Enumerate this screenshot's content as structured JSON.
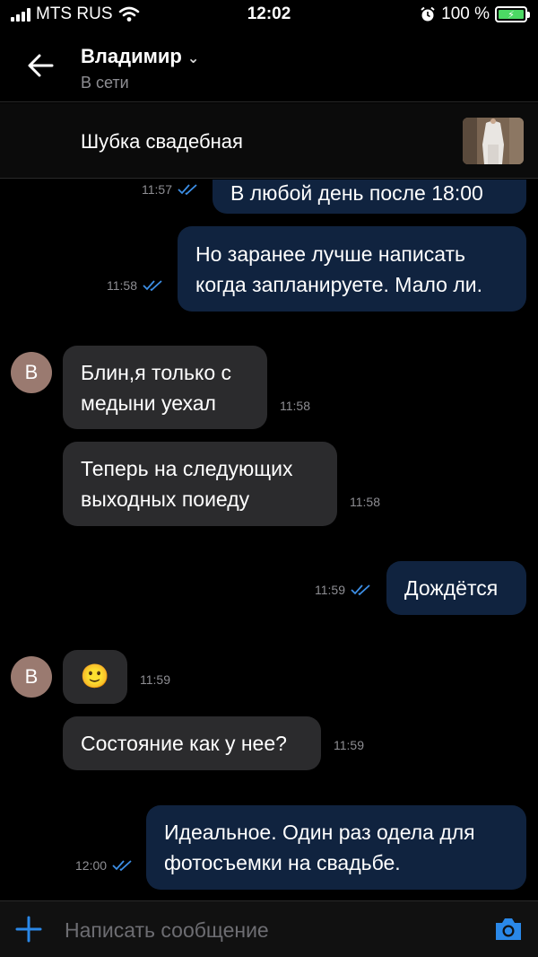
{
  "status_bar": {
    "carrier": "MTS RUS",
    "time": "12:02",
    "battery": "100 %"
  },
  "header": {
    "name": "Владимир",
    "status": "В сети"
  },
  "product": {
    "title": "Шубка свадебная"
  },
  "messages": [
    {
      "direction": "out",
      "text_lines": [
        "В любой день после 18:00"
      ],
      "time": "11:57",
      "read": true
    },
    {
      "direction": "out",
      "text_lines": [
        "Но заранее лучше написать",
        "когда запланируете. Мало ли."
      ],
      "time": "11:58",
      "read": true
    },
    {
      "direction": "in",
      "avatar": "В",
      "text_lines": [
        "Блин,я только с",
        "медыни уехал"
      ],
      "time": "11:58"
    },
    {
      "direction": "in",
      "text_lines": [
        "Теперь на следующих",
        "выходных поиеду"
      ],
      "time": "11:58"
    },
    {
      "direction": "out",
      "text_lines": [
        "Дождётся"
      ],
      "time": "11:59",
      "read": true
    },
    {
      "direction": "in",
      "avatar": "В",
      "text_lines": [
        "🙂"
      ],
      "time": "11:59"
    },
    {
      "direction": "in",
      "text_lines": [
        "Состояние как у нее?"
      ],
      "time": "11:59"
    },
    {
      "direction": "out",
      "text_lines": [
        "Идеальное. Один раз одела для",
        "фотосъемки на свадьбе."
      ],
      "time": "12:00",
      "read": true
    }
  ],
  "composer": {
    "placeholder": "Написать сообщение"
  },
  "colors": {
    "accent": "#2a88e8",
    "outgoing_bubble": "#10233f",
    "incoming_bubble": "#2b2b2d",
    "background": "#000000"
  }
}
